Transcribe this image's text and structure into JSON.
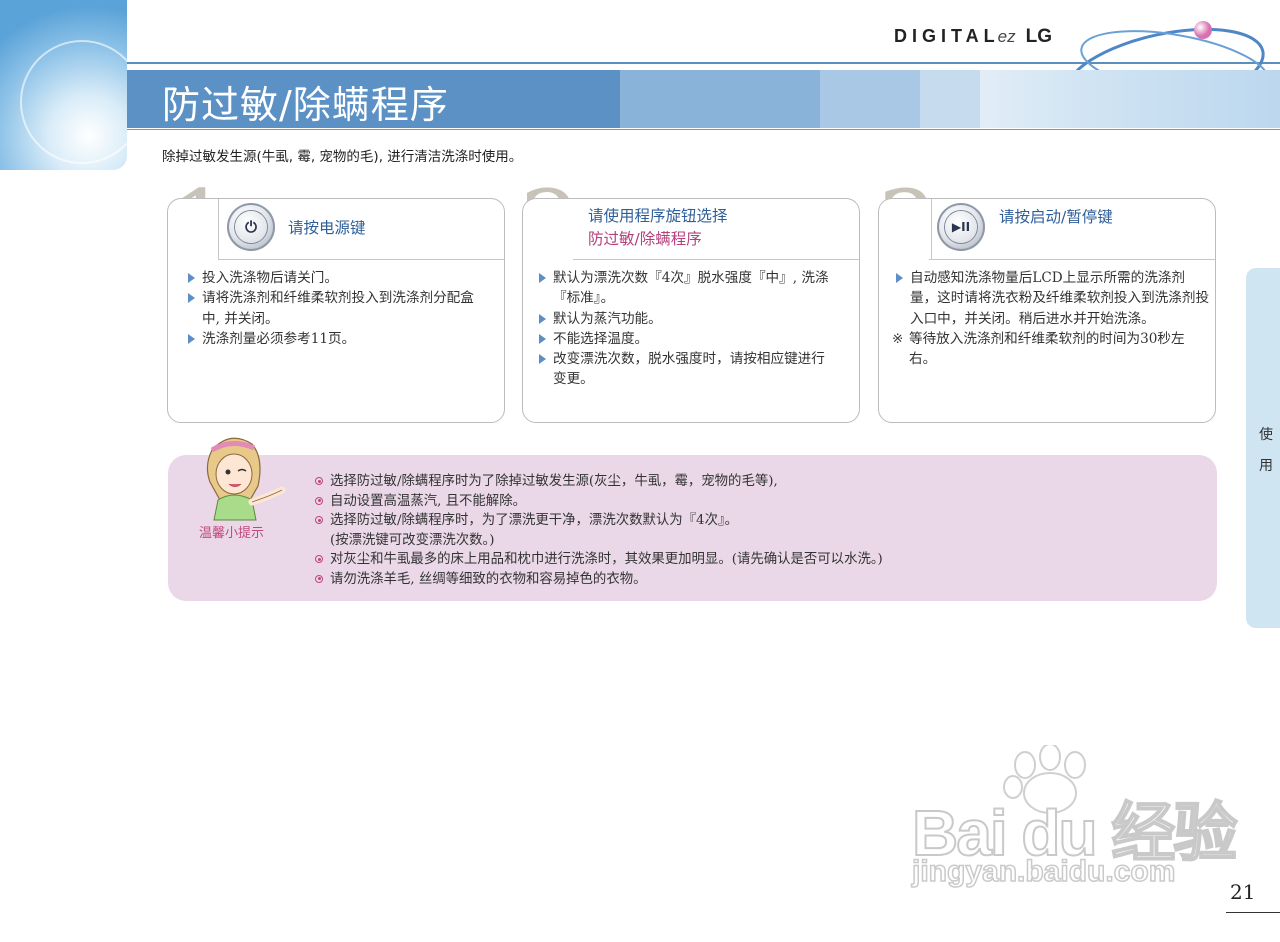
{
  "header": {
    "logo_main": "DIGITAL",
    "logo_ez": "ez",
    "logo_brand": "LG",
    "title": "防过敏/除螨程序"
  },
  "intro": "除掉过敏发生源(牛虱, 霉, 宠物的毛), 进行清洁洗涤时使用。",
  "steps": [
    {
      "number": "1",
      "icon": "power-icon",
      "icon_glyph": "⏻",
      "heading": "请按电源键",
      "items": [
        "投入洗涤物后请关门。",
        "请将洗涤剂和纤维柔软剂投入到洗涤剂分配盒中, 并关闭。",
        "洗涤剂量必须参考11页。"
      ]
    },
    {
      "number": "2",
      "heading_line1": "请使用程序旋钮选择",
      "heading_line2": "防过敏/除螨程序",
      "items": [
        "默认为漂洗次数『4次』脱水强度『中』, 洗涤『标准』。",
        "默认为蒸汽功能。",
        "不能选择温度。",
        "改变漂洗次数，脱水强度时，请按相应键进行变更。"
      ]
    },
    {
      "number": "3",
      "icon": "play-pause-icon",
      "icon_glyph": "▶II",
      "heading": "请按启动/暂停键",
      "items": [
        "自动感知洗涤物量后LCD上显示所需的洗涤剂量，这时请将洗衣粉及纤维柔软剂投入到洗涤剂投入口中，并关闭。稍后进水并开始洗涤。"
      ],
      "note_mark": "※",
      "note": "等待放入洗涤剂和纤维柔软剂的时间为30秒左右。"
    }
  ],
  "tip": {
    "label": "温馨小提示",
    "items": [
      "选择防过敏/除螨程序时为了除掉过敏发生源(灰尘，牛虱，霉，宠物的毛等),",
      "自动设置高温蒸汽, 且不能解除。",
      "选择防过敏/除螨程序时，为了漂洗更干净，漂洗次数默认为『4次』。",
      "(按漂洗键可改变漂洗次数。)",
      "对灰尘和牛虱最多的床上用品和枕巾进行洗涤时，其效果更加明显。(请先确认是否可以水洗。)",
      "请勿洗涤羊毛, 丝绸等细致的衣物和容易掉色的衣物。"
    ]
  },
  "side_tab": {
    "char1": "使",
    "char2": "用"
  },
  "watermark": {
    "line1": "Bai du 经验",
    "line2": "jingyan.baidu.com"
  },
  "page_number": "21",
  "colors": {
    "banner_blue": "#5c91c6",
    "heading_blue": "#2f5f9a",
    "heading_pink": "#b4407c",
    "tip_bg": "#ead8e8",
    "side_tab": "#cfe5f1"
  }
}
